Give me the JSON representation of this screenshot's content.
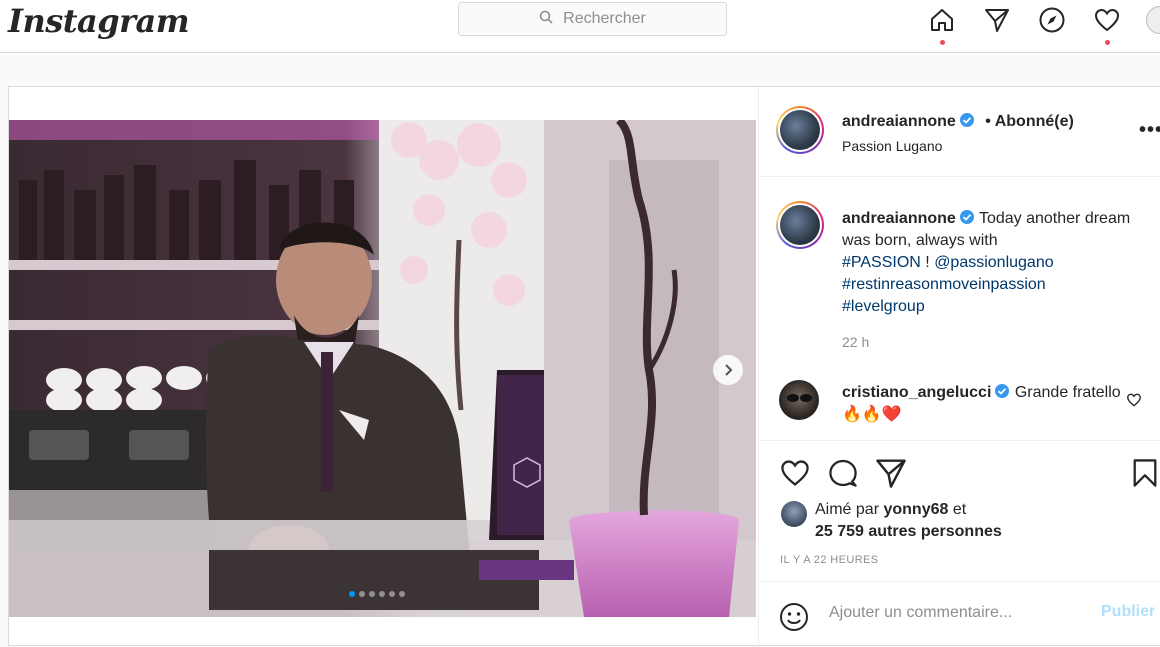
{
  "header": {
    "logo": "Instagram",
    "search_placeholder": "Rechercher",
    "icons": [
      "home-icon",
      "direct-icon",
      "explore-icon",
      "activity-icon",
      "profile-avatar"
    ]
  },
  "post": {
    "author": "andreaiannone",
    "verified": true,
    "follow_status": "• Abonné(e)",
    "location": "Passion Lugano",
    "carousel": {
      "count": 6,
      "active_index": 0
    },
    "caption": {
      "text": "Today another dream was born, always with",
      "hashtag_passion": "#PASSION",
      "separator": " ! ",
      "mention": "@passionlugano",
      "hashtag_2": "#restinreasonmoveinpassion",
      "hashtag_3": "#levelgroup"
    },
    "time": "22 h",
    "comments": [
      {
        "user": "cristiano_angelucci",
        "verified": true,
        "text": "Grande fratello",
        "emoji": "🔥🔥❤️"
      }
    ],
    "likes": {
      "prefix": "Aimé par",
      "user": "yonny68",
      "middle": "et",
      "others": "25 759 autres personnes"
    },
    "timestamp": "IL Y A 22 HEURES",
    "comment_placeholder": "Ajouter un commentaire...",
    "publish_label": "Publier"
  },
  "colors": {
    "accent": "#0095f6",
    "link": "#00376b",
    "notification": "#ed4956",
    "border": "#dbdbdb"
  }
}
